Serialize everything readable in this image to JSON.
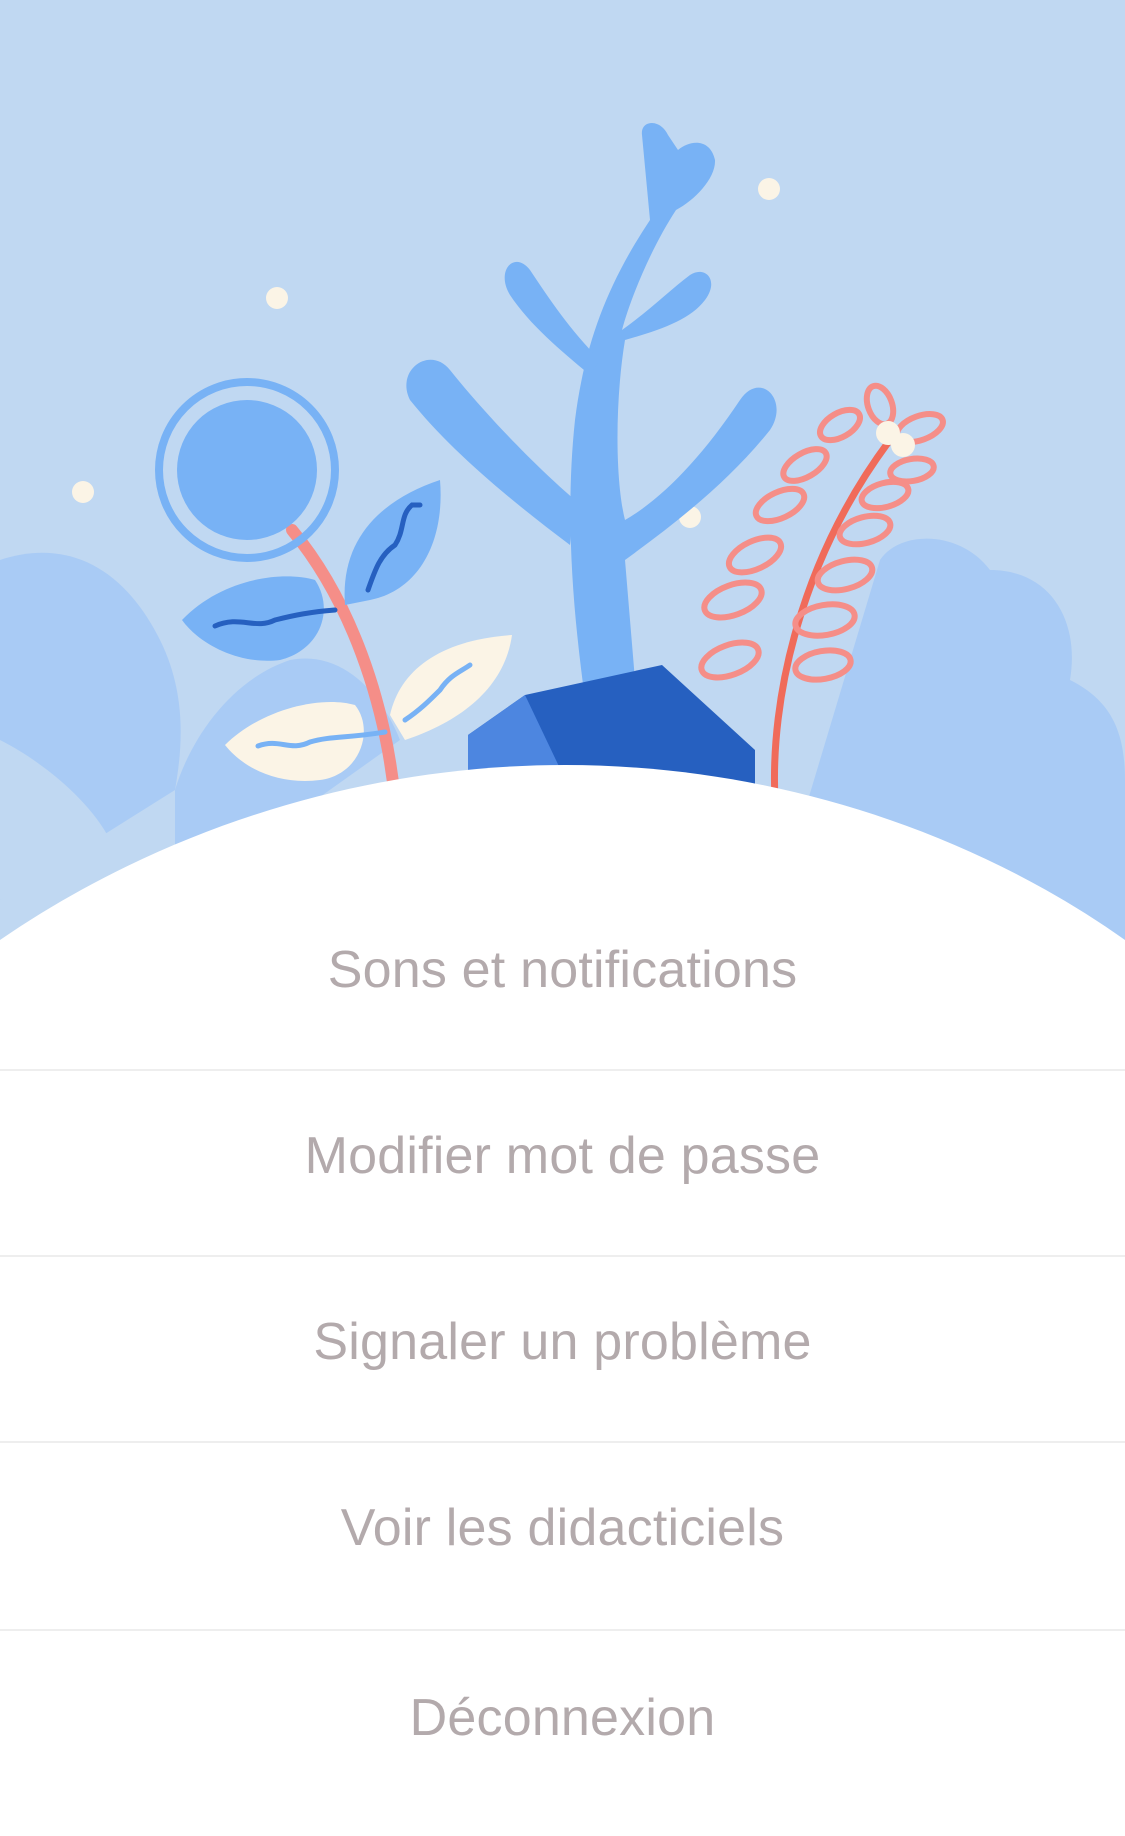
{
  "illustration": {
    "icon": "garden-illustration",
    "colors": {
      "sky": "#c0d8f2",
      "bush": "#a9cbf5",
      "plant_blue": "#78b2f5",
      "dark_blue": "#2660c0",
      "coral": "#f58e88",
      "cream": "#fbf4e6"
    }
  },
  "menu": {
    "items": [
      {
        "label": "Sons et notifications"
      },
      {
        "label": "Modifier mot de passe"
      },
      {
        "label": "Signaler un problème"
      },
      {
        "label": "Voir les didacticiels"
      },
      {
        "label": "Déconnexion"
      }
    ]
  }
}
